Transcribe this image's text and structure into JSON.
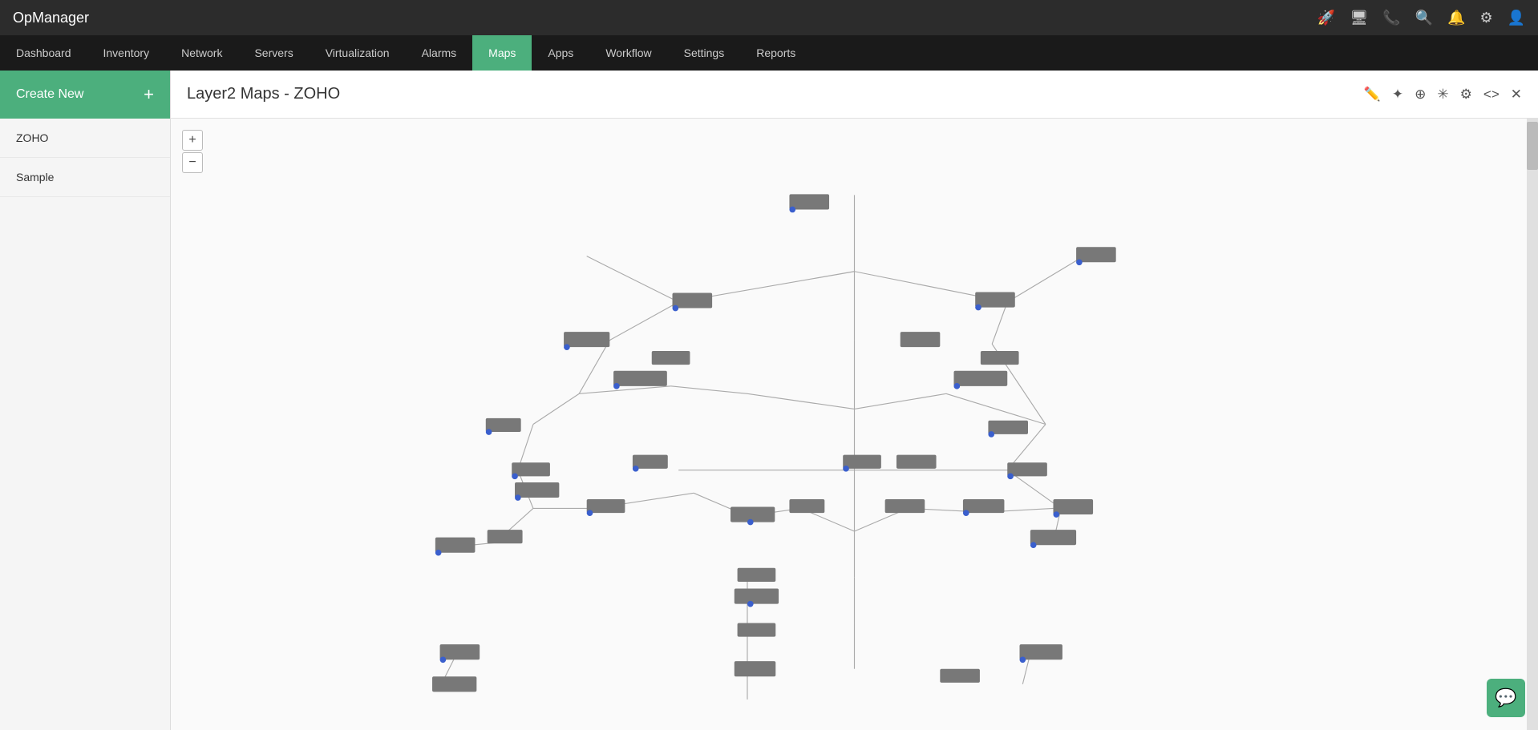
{
  "app": {
    "title": "OpManager"
  },
  "topbar": {
    "icons": [
      "rocket-icon",
      "monitor-icon",
      "bell-badge-icon",
      "search-icon",
      "notification-icon",
      "settings-icon",
      "user-icon"
    ]
  },
  "navbar": {
    "items": [
      {
        "label": "Dashboard",
        "active": false
      },
      {
        "label": "Inventory",
        "active": false
      },
      {
        "label": "Network",
        "active": false
      },
      {
        "label": "Servers",
        "active": false
      },
      {
        "label": "Virtualization",
        "active": false
      },
      {
        "label": "Alarms",
        "active": false
      },
      {
        "label": "Maps",
        "active": true
      },
      {
        "label": "Apps",
        "active": false
      },
      {
        "label": "Workflow",
        "active": false
      },
      {
        "label": "Settings",
        "active": false
      },
      {
        "label": "Reports",
        "active": false
      }
    ]
  },
  "sidebar": {
    "create_new_label": "Create New",
    "plus_symbol": "+",
    "items": [
      {
        "label": "ZOHO"
      },
      {
        "label": "Sample"
      }
    ]
  },
  "content": {
    "title": "Layer2 Maps - ZOHO",
    "actions": {
      "edit_label": "✎",
      "nodes_label": "⊕",
      "share_label": "⊘",
      "layout_label": "⌘",
      "settings_label": "⚙",
      "code_label": "<>",
      "close_label": "✕"
    }
  },
  "zoom": {
    "plus": "+",
    "minus": "−"
  },
  "chat": {
    "icon": "💬"
  }
}
